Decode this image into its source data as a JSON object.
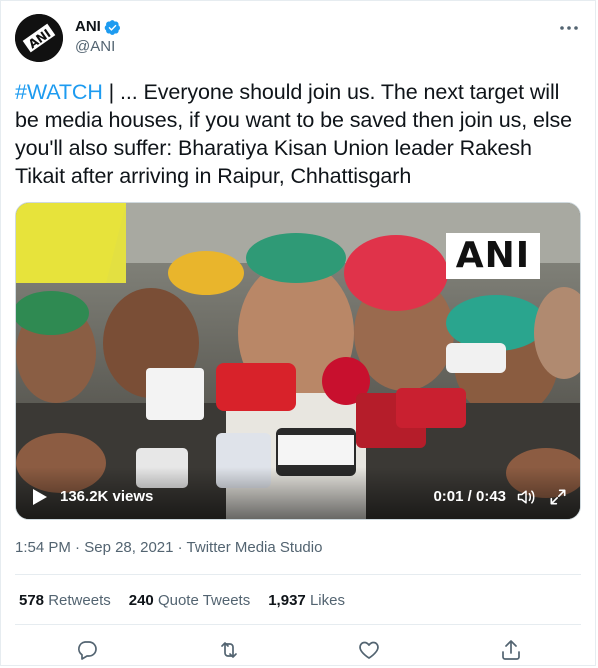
{
  "author": {
    "display_name": "ANI",
    "handle": "@ANI",
    "avatar_icon": "ani-logo-icon",
    "verified": true
  },
  "tweet": {
    "hashtag": "#WATCH",
    "text": " | ... Everyone should join us. The next target will be media houses, if you want to be saved then join us, else you'll also suffer: Bharatiya Kisan Union leader Rakesh Tikait after arriving in Raipur, Chhattisgarh"
  },
  "media": {
    "watermark": "ANI",
    "views": "136.2K views",
    "time": "0:01 / 0:43"
  },
  "meta": {
    "time": "1:54 PM",
    "separator1": " · ",
    "date": "Sep 28, 2021",
    "separator2": " · ",
    "source": "Twitter Media Studio"
  },
  "stats": {
    "retweets_count": "578",
    "retweets_label": "Retweets",
    "quotes_count": "240",
    "quotes_label": "Quote Tweets",
    "likes_count": "1,937",
    "likes_label": "Likes"
  },
  "colors": {
    "accent": "#1d9bf0",
    "text": "#0f1419",
    "muted": "#536471"
  }
}
